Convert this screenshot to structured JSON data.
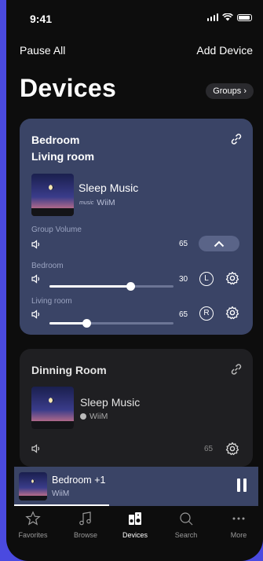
{
  "status": {
    "time": "9:41"
  },
  "header": {
    "pause_all": "Pause All",
    "add_device": "Add Device",
    "title": "Devices",
    "groups_label": "Groups"
  },
  "group_card": {
    "rooms": [
      "Bedroom",
      "Living room"
    ],
    "track": "Sleep Music",
    "source": "WiiM",
    "group_volume_label": "Group Volume",
    "group_volume": 65,
    "devices": [
      {
        "name": "Bedroom",
        "volume": 30,
        "channel": "L"
      },
      {
        "name": "Living room",
        "volume": 65,
        "channel": "R"
      }
    ]
  },
  "single_card": {
    "room": "Dinning Room",
    "track": "Sleep Music",
    "source": "WiiM",
    "volume": 65
  },
  "mini_player": {
    "title": "Bedroom +1",
    "subtitle": "WiiM",
    "progress": 0.39
  },
  "tabs": [
    {
      "label": "Favorites",
      "icon": "star-icon",
      "active": false
    },
    {
      "label": "Browse",
      "icon": "music-note-icon",
      "active": false
    },
    {
      "label": "Devices",
      "icon": "speakers-icon",
      "active": true
    },
    {
      "label": "Search",
      "icon": "search-icon",
      "active": false
    },
    {
      "label": "More",
      "icon": "more-icon",
      "active": false
    }
  ],
  "colors": {
    "background": "#4a4ae0",
    "card_active": "#3a4466",
    "card_idle": "#1f1f22"
  }
}
